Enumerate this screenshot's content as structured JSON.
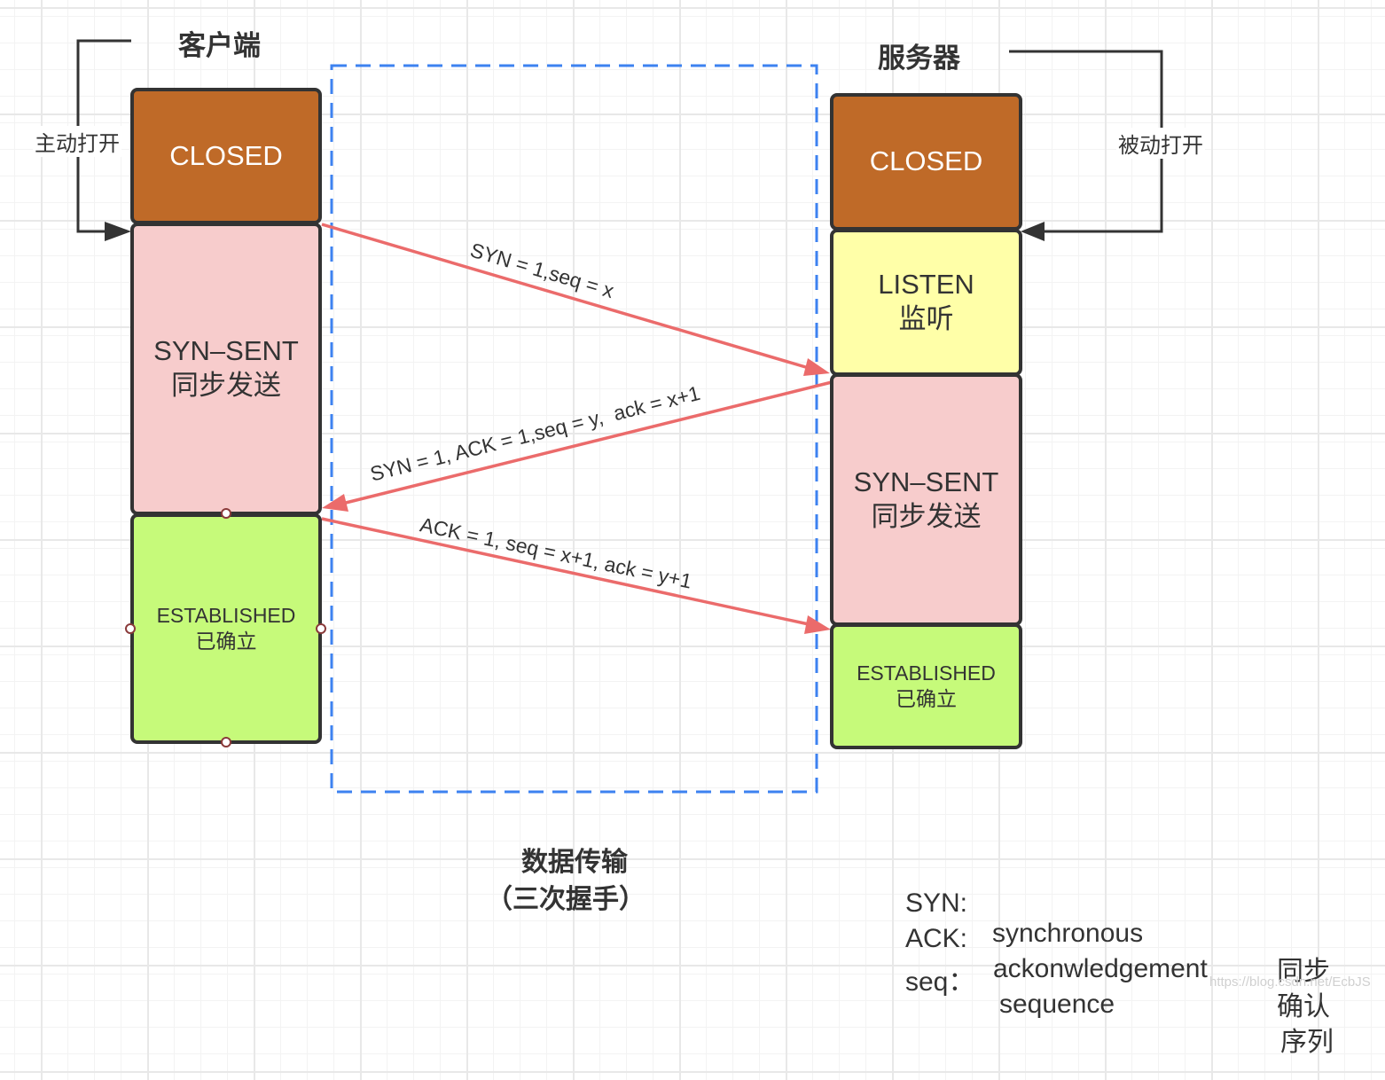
{
  "client": {
    "title": "客户端",
    "open_label": "主动打开",
    "states": [
      {
        "id": "closed",
        "line1": "CLOSED",
        "line2": ""
      },
      {
        "id": "syn-sent",
        "line1": "SYN–SENT",
        "line2": "同步发送"
      },
      {
        "id": "established",
        "line1": "ESTABLISHED",
        "line2": "已确立"
      }
    ]
  },
  "server": {
    "title": "服务器",
    "open_label": "被动打开",
    "states": [
      {
        "id": "closed",
        "line1": "CLOSED",
        "line2": ""
      },
      {
        "id": "listen",
        "line1": "LISTEN",
        "line2": "监听"
      },
      {
        "id": "syn-sent",
        "line1": "SYN–SENT",
        "line2": "同步发送"
      },
      {
        "id": "established",
        "line1": "ESTABLISHED",
        "line2": "已确立"
      }
    ]
  },
  "messages": [
    {
      "label": "SYN = 1,seq = x",
      "direction": "client-to-server"
    },
    {
      "label": "SYN = 1, ACK = 1,seq = y,  ack = x+1",
      "direction": "server-to-client"
    },
    {
      "label": "ACK = 1, seq = x+1, ack = y+1",
      "direction": "client-to-server"
    }
  ],
  "caption": {
    "line1": "数据传输",
    "line2": "（三次握手）"
  },
  "legend": [
    {
      "abbr": "SYN:",
      "term": "synchronous",
      "meaning": "同步"
    },
    {
      "abbr": "ACK:",
      "term": "ackonwledgement",
      "meaning": "确认"
    },
    {
      "abbr": "seq：",
      "term": "sequence",
      "meaning": "序列"
    }
  ],
  "watermark": "https://blog.csdn.net/EcbJS",
  "colors": {
    "closed": "#bf6a28",
    "listen": "#ffffa8",
    "syn_sent": "#f7cccc",
    "established": "#c6fa7a",
    "arrow": "#eb6b6b",
    "dashed_frame": "#3d82f0",
    "connector": "#333333"
  }
}
